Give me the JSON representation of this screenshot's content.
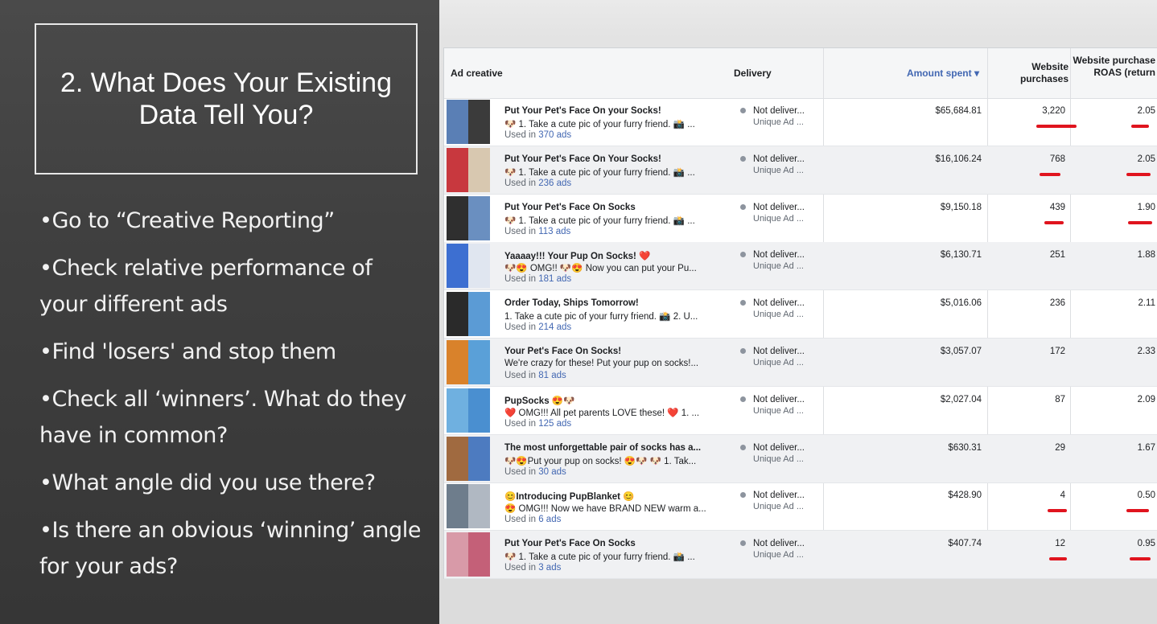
{
  "slide": {
    "title": "2. What Does Your Existing Data Tell You?",
    "bullets": [
      "•Go to “Creative Reporting”",
      "•Check relative performance of your different ads",
      "•Find 'losers' and stop them",
      "•Check all ‘winners’. What do they have in common?",
      "•What angle did you use there?",
      "•Is there an obvious ‘winning’ angle for your ads?"
    ]
  },
  "table": {
    "headers": {
      "creative": "Ad creative",
      "delivery": "Delivery",
      "amount": "Amount spent ▾",
      "purchases": "Website purchases",
      "roas": "Website purchase ROAS (return"
    },
    "rows": [
      {
        "title": "Put Your Pet's Face On your Socks!",
        "body": "🐶 1. Take a cute pic of your furry friend. 📸 ...",
        "used_prefix": "Used in",
        "used_count": "370 ads",
        "delivery": "Not deliver...",
        "delivery_sub": "Unique Ad ...",
        "amount": "$65,684.81",
        "purchases": "3,220",
        "roas": "2.05"
      },
      {
        "title": "Put Your Pet's Face On Your Socks!",
        "body": "🐶 1. Take a cute pic of your furry friend. 📸 ...",
        "used_prefix": "Used in",
        "used_count": "236 ads",
        "delivery": "Not deliver...",
        "delivery_sub": "Unique Ad ...",
        "amount": "$16,106.24",
        "purchases": "768",
        "roas": "2.05"
      },
      {
        "title": "Put Your Pet's Face On Socks",
        "body": "🐶 1. Take a cute pic of your furry friend. 📸 ...",
        "used_prefix": "Used in",
        "used_count": "113 ads",
        "delivery": "Not deliver...",
        "delivery_sub": "Unique Ad ...",
        "amount": "$9,150.18",
        "purchases": "439",
        "roas": "1.90"
      },
      {
        "title": "Yaaaay!!! Your Pup On Socks! ❤️",
        "body": "🐶😍 OMG!! 🐶😍 Now you can put your Pu...",
        "used_prefix": "Used in",
        "used_count": "181 ads",
        "delivery": "Not deliver...",
        "delivery_sub": "Unique Ad ...",
        "amount": "$6,130.71",
        "purchases": "251",
        "roas": "1.88"
      },
      {
        "title": "Order Today, Ships Tomorrow!",
        "body": "1. Take a cute pic of your furry friend. 📸 2. U...",
        "used_prefix": "Used in",
        "used_count": "214 ads",
        "delivery": "Not deliver...",
        "delivery_sub": "Unique Ad ...",
        "amount": "$5,016.06",
        "purchases": "236",
        "roas": "2.11"
      },
      {
        "title": "Your Pet's Face On Socks!",
        "body": "We're crazy for these! Put your pup on socks!...",
        "used_prefix": "Used in",
        "used_count": "81 ads",
        "delivery": "Not deliver...",
        "delivery_sub": "Unique Ad ...",
        "amount": "$3,057.07",
        "purchases": "172",
        "roas": "2.33"
      },
      {
        "title": "PupSocks 😍🐶",
        "body": "❤️ OMG!!! All pet parents LOVE these! ❤️ 1. ...",
        "used_prefix": "Used in",
        "used_count": "125 ads",
        "delivery": "Not deliver...",
        "delivery_sub": "Unique Ad ...",
        "amount": "$2,027.04",
        "purchases": "87",
        "roas": "2.09"
      },
      {
        "title": "The most unforgettable pair of socks has a...",
        "body": "🐶😍Put your pup on socks! 😍🐶 🐶 1. Tak...",
        "used_prefix": "Used in",
        "used_count": "30 ads",
        "delivery": "Not deliver...",
        "delivery_sub": "Unique Ad ...",
        "amount": "$630.31",
        "purchases": "29",
        "roas": "1.67"
      },
      {
        "title": "😊Introducing PupBlanket 😊",
        "body": "😍 OMG!!! Now we have BRAND NEW warm a...",
        "used_prefix": "Used in",
        "used_count": "6 ads",
        "delivery": "Not deliver...",
        "delivery_sub": "Unique Ad ...",
        "amount": "$428.90",
        "purchases": "4",
        "roas": "0.50"
      },
      {
        "title": "Put Your Pet's Face On Socks",
        "body": "🐶 1. Take a cute pic of your furry friend. 📸 ...",
        "used_prefix": "Used in",
        "used_count": "3 ads",
        "delivery": "Not deliver...",
        "delivery_sub": "Unique Ad ...",
        "amount": "$407.74",
        "purchases": "12",
        "roas": "0.95"
      }
    ]
  },
  "colors": {
    "accent": "#4267b2",
    "annotation": "#e0141e"
  }
}
